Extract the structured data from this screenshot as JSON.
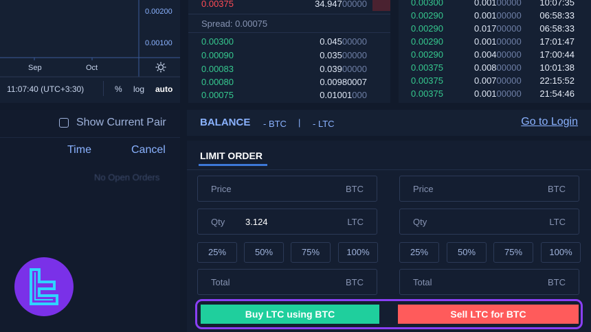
{
  "chart": {
    "y_ticks": [
      "0.00200",
      "0.00100"
    ],
    "x_ticks": [
      "Sep",
      "Oct"
    ],
    "time": "11:07:40 (UTC+3:30)",
    "pct": "%",
    "log": "log",
    "auto": "auto",
    "settings_icon": "settings-icon"
  },
  "book": {
    "top_ask": {
      "price": "0.00375",
      "qty_main": "34.947",
      "qty_dim": "00000"
    },
    "spread": "Spread: 0.00075",
    "bids": [
      {
        "price": "0.00300",
        "qty_main": "0.045",
        "qty_dim": "00000"
      },
      {
        "price": "0.00090",
        "qty_main": "0.035",
        "qty_dim": "00000"
      },
      {
        "price": "0.00083",
        "qty_main": "0.039",
        "qty_dim": "00000"
      },
      {
        "price": "0.00080",
        "qty_main": "0.00980007",
        "qty_dim": ""
      },
      {
        "price": "0.00075",
        "qty_main": "0.01001",
        "qty_dim": "000"
      }
    ]
  },
  "trades": [
    {
      "price": "0.00300",
      "qty_main": "0.001",
      "qty_dim": "00000",
      "time": "10:07:35"
    },
    {
      "price": "0.00290",
      "qty_main": "0.001",
      "qty_dim": "00000",
      "time": "06:58:33"
    },
    {
      "price": "0.00290",
      "qty_main": "0.017",
      "qty_dim": "00000",
      "time": "06:58:33"
    },
    {
      "price": "0.00290",
      "qty_main": "0.001",
      "qty_dim": "00000",
      "time": "17:01:47"
    },
    {
      "price": "0.00290",
      "qty_main": "0.004",
      "qty_dim": "00000",
      "time": "17:00:44"
    },
    {
      "price": "0.00375",
      "qty_main": "0.008",
      "qty_dim": "00000",
      "time": "10:01:38"
    },
    {
      "price": "0.00375",
      "qty_main": "0.007",
      "qty_dim": "00000",
      "time": "22:15:52"
    },
    {
      "price": "0.00375",
      "qty_main": "0.001",
      "qty_dim": "00000",
      "time": "21:54:46"
    }
  ],
  "orders": {
    "show_current_pair": "Show Current Pair",
    "col_time": "Time",
    "col_cancel": "Cancel",
    "empty": "No Open Orders"
  },
  "balance": {
    "title": "BALANCE",
    "btc": "- BTC",
    "sep": "|",
    "ltc": "- LTC",
    "login": "Go to Login"
  },
  "limit": {
    "tab": "LIMIT ORDER",
    "buy": {
      "price_label": "Price",
      "price_unit": "BTC",
      "qty_label": "Qty",
      "qty_value": "3.124",
      "qty_unit": "LTC",
      "total_label": "Total",
      "total_unit": "BTC"
    },
    "sell": {
      "price_label": "Price",
      "price_unit": "BTC",
      "qty_label": "Qty",
      "qty_value": "",
      "qty_unit": "LTC",
      "total_label": "Total",
      "total_unit": "BTC"
    },
    "percents": [
      "25%",
      "50%",
      "75%",
      "100%"
    ],
    "buy_button": "Buy LTC using BTC",
    "sell_button": "Sell LTC for BTC"
  },
  "colors": {
    "bid": "#36c98f",
    "ask": "#ff4b55",
    "buy": "#1fcf9d",
    "sell": "#ff5b5b",
    "highlight": "#8a3ff5",
    "link": "#8ab2ff"
  }
}
